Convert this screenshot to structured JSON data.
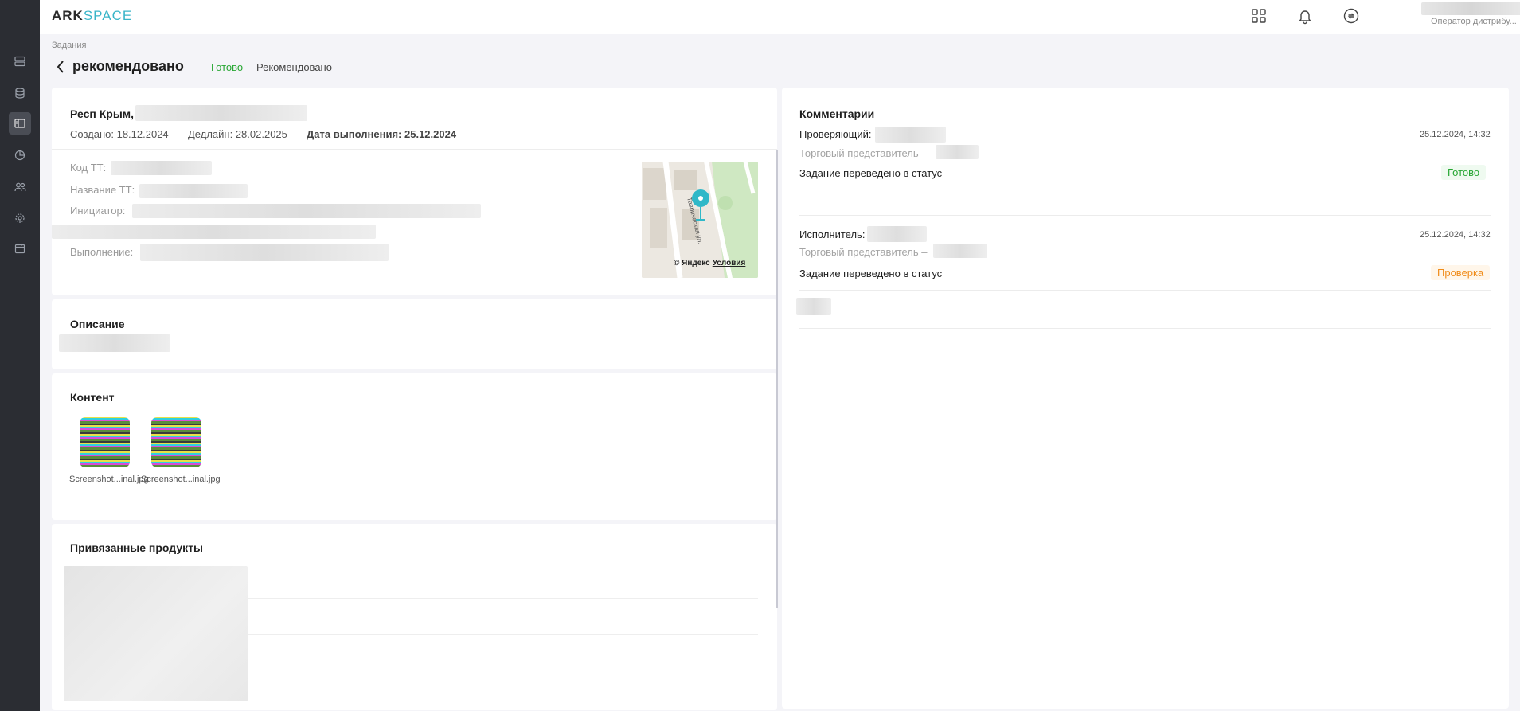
{
  "brand": {
    "part1": "ARK",
    "part2": "SPACE"
  },
  "user": {
    "role": "Оператор дистрибу..."
  },
  "breadcrumb": "Задания",
  "page": {
    "title": "рекомендовано",
    "tabs": [
      {
        "label": "Готово"
      },
      {
        "label": "Рекомендовано"
      }
    ]
  },
  "task": {
    "region": "Респ Крым,",
    "created": "Создано: 18.12.2024",
    "deadline": "Дедлайн: 28.02.2025",
    "done_label": "Дата выполнения:",
    "done_value": "25.12.2024",
    "fields": {
      "code": "Код ТТ:",
      "name": "Название ТТ:",
      "initiator": "Инициатор:",
      "execution": "Выполнение:"
    },
    "map": {
      "credit": "© Яндекс",
      "terms": "Условия",
      "street": "Таврическая ул."
    }
  },
  "description": {
    "title": "Описание"
  },
  "content": {
    "title": "Контент",
    "files": [
      {
        "name": "Screenshot...inal.jpg"
      },
      {
        "name": "Screenshot...inal.jpg"
      }
    ]
  },
  "products": {
    "title": "Привязанные продукты"
  },
  "comments": {
    "title": "Комментарии",
    "items": [
      {
        "role": "Проверяющий:",
        "date": "25.12.2024, 14:32",
        "sub": "Торговый представитель –",
        "text": "Задание переведено в статус",
        "status": "Готово"
      },
      {
        "role": "Исполнитель:",
        "date": "25.12.2024, 14:32",
        "sub": "Торговый представитель –",
        "text": "Задание переведено в статус",
        "status": "Проверка"
      }
    ]
  },
  "colors": {
    "accent": "#39b5c8",
    "ready": "#26a632",
    "review": "#f08c1a",
    "sidebar": "#2b2d33"
  }
}
